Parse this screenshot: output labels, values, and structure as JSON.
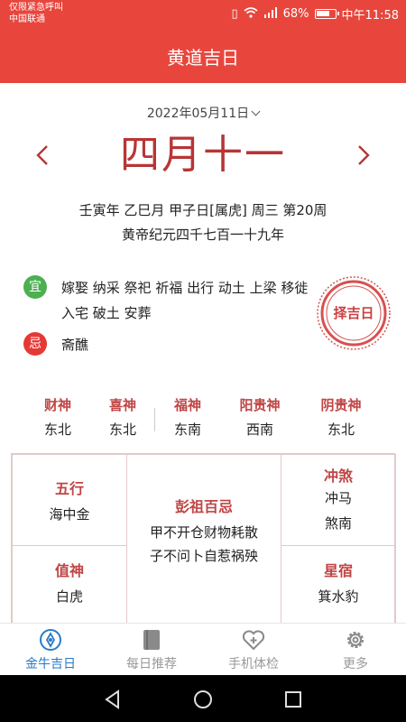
{
  "statusbar": {
    "carrier_line1": "仅限紧急呼叫",
    "carrier_line2": "中国联通",
    "battery": "68%",
    "time": "中午11:58"
  },
  "appbar": {
    "title": "黄道吉日"
  },
  "date": {
    "selected": "2022年05月11日",
    "lunar": "四月十一",
    "info_line1": "壬寅年 乙巳月 甲子日[属虎] 周三 第20周",
    "info_line2": "黄帝纪元四千七百一十九年"
  },
  "yi": {
    "badge": "宜",
    "text": "嫁娶 纳采 祭祀 祈福 出行 动土 上梁 移徙 入宅 破土 安葬"
  },
  "ji": {
    "badge": "忌",
    "text": "斋醮"
  },
  "stamp": {
    "label": "择吉日"
  },
  "gods": [
    {
      "name": "财神",
      "dir": "东北"
    },
    {
      "name": "喜神",
      "dir": "东北"
    },
    {
      "name": "福神",
      "dir": "东南"
    },
    {
      "name": "阳贵神",
      "dir": "西南"
    },
    {
      "name": "阴贵神",
      "dir": "东北"
    }
  ],
  "grid": {
    "wuxing": {
      "title": "五行",
      "value": "海中金"
    },
    "pengzu": {
      "title": "彭祖百忌",
      "line1": "甲不开仓财物耗散",
      "line2": "子不问卜自惹祸殃"
    },
    "chongsha": {
      "title": "冲煞",
      "line1": "冲马",
      "line2": "煞南"
    },
    "zhishen": {
      "title": "值神",
      "value": "白虎"
    },
    "xingxiu": {
      "title": "星宿",
      "value": "箕水豹"
    }
  },
  "nav": [
    {
      "label": "金牛吉日",
      "icon": "compass-icon",
      "active": true
    },
    {
      "label": "每日推荐",
      "icon": "book-icon",
      "active": false
    },
    {
      "label": "手机体检",
      "icon": "heart-plus-icon",
      "active": false
    },
    {
      "label": "更多",
      "icon": "gear-icon",
      "active": false
    }
  ],
  "colors": {
    "primary": "#e8463d",
    "accent_red": "#b83535",
    "nav_active": "#2a7ac8"
  }
}
